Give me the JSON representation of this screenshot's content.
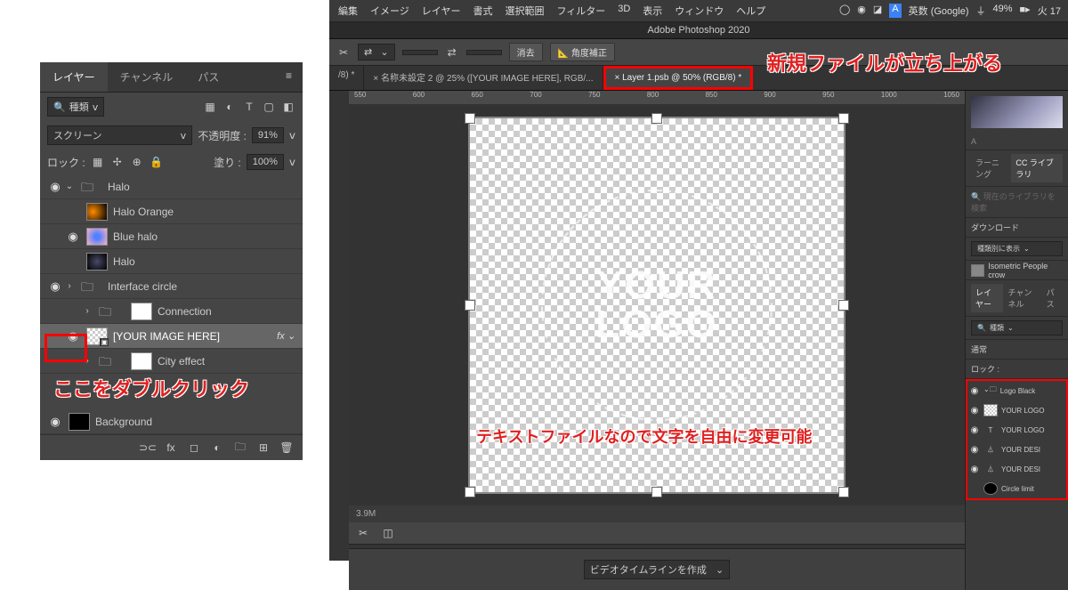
{
  "left_panel": {
    "tabs": [
      "レイヤー",
      "チャンネル",
      "パス"
    ],
    "filter_label": "種類",
    "blend_mode": "スクリーン",
    "opacity_label": "不透明度 :",
    "opacity_value": "91%",
    "lock_label": "ロック :",
    "fill_label": "塗り :",
    "fill_value": "100%",
    "layers": [
      {
        "name": "Halo",
        "type": "group"
      },
      {
        "name": "Halo Orange",
        "indent": 1,
        "thumb": "orange"
      },
      {
        "name": "Blue halo",
        "indent": 1,
        "thumb": "blue"
      },
      {
        "name": "Halo",
        "indent": 1,
        "thumb": "halo"
      },
      {
        "name": "Interface circle",
        "type": "group"
      },
      {
        "name": "Connection",
        "indent": 1,
        "thumb": "white",
        "mask": true
      },
      {
        "name": "[YOUR IMAGE HERE]",
        "indent": 1,
        "selected": true,
        "fx": true,
        "thumb": "checker"
      },
      {
        "name": "City effect",
        "indent": 1,
        "thumb": "black",
        "mask": true
      },
      {
        "name": "Background",
        "thumb": "black"
      }
    ]
  },
  "annotations": {
    "dbl_click": "ここをダブルクリック",
    "new_file": "新規ファイルが立ち上がる",
    "text_editable": "テキストファイルなので文字を自由に変更可能"
  },
  "ps": {
    "menu": [
      "編集",
      "イメージ",
      "レイヤー",
      "書式",
      "選択範囲",
      "フィルター",
      "3D",
      "表示",
      "ウィンドウ",
      "ヘルプ"
    ],
    "mac_status": [
      "◯",
      "◉",
      "◪",
      "A",
      "英数 (Google)",
      "⏚",
      "49%",
      "■▸",
      "火 17"
    ],
    "title": "Adobe Photoshop 2020",
    "opts_straighten": "角度補正",
    "opts_clear": "消去",
    "tabs": [
      {
        "label": "/8) *"
      },
      {
        "label": "× 名称未設定 2 @ 25% ([YOUR IMAGE HERE], RGB/..."
      },
      {
        "label": "× Layer 1.psb @ 50% (RGB/8) *",
        "highlight": true
      }
    ],
    "ruler_marks": [
      "550",
      "600",
      "650",
      "700",
      "750",
      "800",
      "850",
      "900",
      "950",
      "1000",
      "1050"
    ],
    "logo_text1": "YOUR",
    "logo_text2": "LOGO",
    "status": "3.9M",
    "timeline_btn": "ビデオタイムラインを作成"
  },
  "rpanel": {
    "tabs": [
      "ラーニング",
      "CC ライブラリ"
    ],
    "search_placeholder": "現在のライブラリを検索",
    "download": "ダウンロード",
    "display_by": "種類別に表示",
    "asset": "Isometric People crow",
    "layer_tabs": [
      "レイヤー",
      "チャンネル",
      "パス"
    ],
    "filter": "種類",
    "blend": "通常",
    "lock": "ロック :",
    "group": "Logo Black",
    "layers": [
      {
        "name": "YOUR LOGO",
        "thumb": "checker"
      },
      {
        "name": "YOUR LOGO",
        "icon": "T"
      },
      {
        "name": "YOUR DESI",
        "icon": "⏃"
      },
      {
        "name": "YOUR DESI",
        "icon": "⏃"
      },
      {
        "name": "Circle limit",
        "thumb": "black"
      }
    ]
  }
}
